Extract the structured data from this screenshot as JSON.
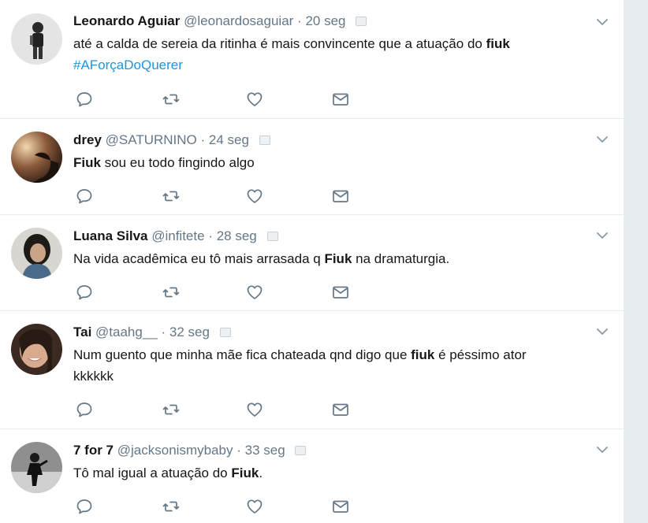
{
  "tweets": [
    {
      "name": "Leonardo Aguiar",
      "handle": "@leonardosaguiar",
      "separator": "·",
      "time": "20 seg",
      "text_parts": [
        "até a calda de sereia da ritinha é mais convincente que a atuação do ",
        "fiuk"
      ],
      "hashtag": "#AForçaDoQuerer"
    },
    {
      "name": "drey",
      "handle": "@SATURNINO",
      "separator": "·",
      "time": "24 seg",
      "text_parts": [
        "Fiuk",
        " sou eu todo fingindo algo"
      ]
    },
    {
      "name": "Luana Silva",
      "handle": "@infitete",
      "separator": "·",
      "time": "28 seg",
      "text_parts": [
        "Na vida acadêmica eu tô mais arrasada q ",
        "Fiuk",
        " na dramaturgia."
      ]
    },
    {
      "name": "Tai",
      "handle": "@taahg__",
      "separator": "·",
      "time": "32 seg",
      "text_parts": [
        "Num guento que minha mãe fica chateada qnd digo que ",
        "fiuk",
        " é péssimo ator",
        "kkkkkk"
      ]
    },
    {
      "name": "7 for 7",
      "handle": "@jacksonismybaby",
      "separator": "·",
      "time": "33 seg",
      "text_parts": [
        "Tô mal igual a atuação do ",
        "Fiuk",
        "."
      ]
    }
  ],
  "icons": {
    "reply": "reply-icon",
    "retweet": "retweet-icon",
    "like": "heart-icon",
    "dm": "envelope-icon",
    "caret": "chevron-down-icon"
  },
  "colors": {
    "text": "#14171a",
    "secondary": "#657786",
    "link": "#1b95e0",
    "border": "#e6ecf0",
    "icon": "#657786"
  }
}
